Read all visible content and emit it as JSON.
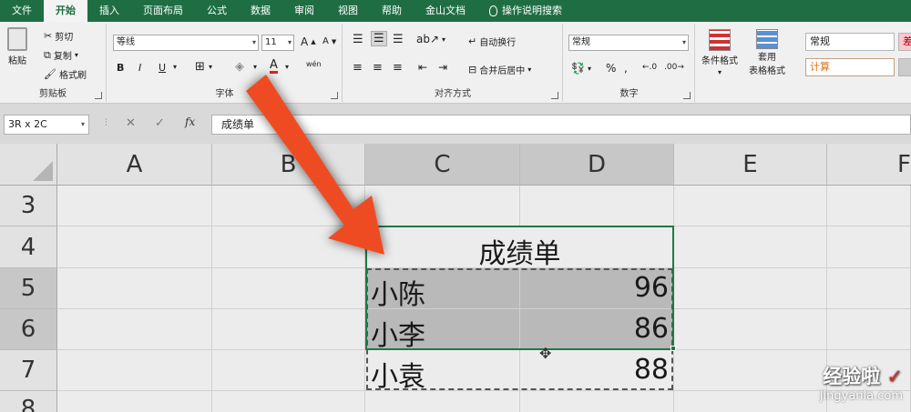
{
  "menubar": {
    "tabs": [
      "文件",
      "开始",
      "插入",
      "页面布局",
      "公式",
      "数据",
      "审阅",
      "视图",
      "帮助",
      "金山文档"
    ],
    "tellme": "操作说明搜索"
  },
  "ribbon": {
    "clipboard": {
      "paste": "粘贴",
      "cut": "剪切",
      "copy": "复制",
      "format_painter": "格式刷",
      "label": "剪贴板"
    },
    "font": {
      "font_name": "等线",
      "font_size": "11",
      "bold": "B",
      "italic": "I",
      "underline": "U",
      "grow": "A",
      "shrink": "A",
      "font_color": "A",
      "phonetic": "wén",
      "label": "字体"
    },
    "alignment": {
      "wrap": "自动换行",
      "merge": "合并后居中",
      "label": "对齐方式"
    },
    "number": {
      "format": "常规",
      "percent": "%",
      "comma": ",",
      "label": "数字"
    },
    "styles": {
      "conditional": "条件格式",
      "table_1": "套用",
      "table_2": "表格格式",
      "normal": "常规",
      "calc": "计算",
      "bad": "差"
    }
  },
  "formula_bar": {
    "name_box": "3R x 2C",
    "cancel": "✕",
    "enter": "✓",
    "fx": "fx",
    "content": "成绩单"
  },
  "grid": {
    "columns": [
      "A",
      "B",
      "C",
      "D",
      "E",
      "F"
    ],
    "rows": [
      "3",
      "4",
      "5",
      "6",
      "7",
      "8"
    ],
    "title": "成绩单",
    "records": [
      {
        "name": "小陈",
        "score": "96"
      },
      {
        "name": "小李",
        "score": "86"
      },
      {
        "name": "小袁",
        "score": "88"
      }
    ]
  },
  "watermark": {
    "brand": "经验啦",
    "check": "✓",
    "url": "jingyanla.com"
  }
}
